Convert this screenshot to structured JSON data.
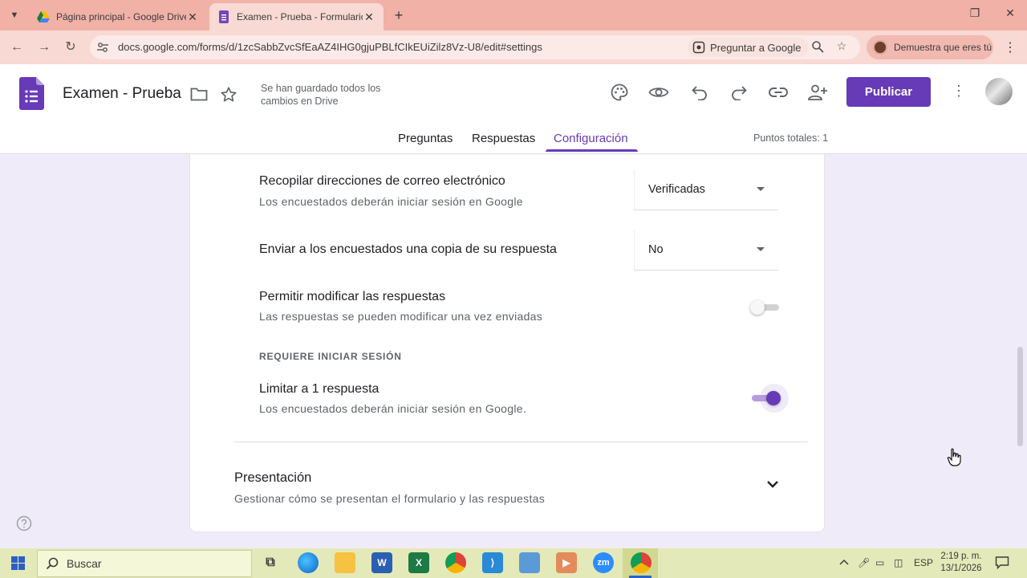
{
  "browser": {
    "tabs": [
      {
        "title": "Página principal - Google Drive",
        "active": false,
        "favicon": "google-drive-icon"
      },
      {
        "title": "Examen - Prueba - Formularios",
        "active": true,
        "favicon": "google-forms-icon"
      }
    ],
    "new_tab_glyph": "+",
    "url": "docs.google.com/forms/d/1zcSabbZvcSfEaAZ4IHG0gjuPBLfCIkEUiZilz8Vz-U8/edit#settings",
    "ask_google": "Preguntar a Google",
    "profile_chip": "Demuestra que eres tú"
  },
  "header": {
    "doc_title": "Examen - Prueba",
    "save_status": "Se han guardado todos los cambios en Drive",
    "publish_label": "Publicar",
    "tabs": [
      "Preguntas",
      "Respuestas",
      "Configuración"
    ],
    "active_tab": "Configuración",
    "total_points": "Puntos totales: 1"
  },
  "settings": {
    "collect_email": {
      "title": "Recopilar direcciones de correo electrónico",
      "subtitle": "Los encuestados deberán iniciar sesión en Google",
      "value": "Verificadas"
    },
    "send_copy": {
      "title": "Enviar a los encuestados una copia de su respuesta",
      "value": "No"
    },
    "allow_edit": {
      "title": "Permitir modificar las respuestas",
      "subtitle": "Las respuestas se pueden modificar una vez enviadas",
      "enabled": false
    },
    "section_label": "REQUIERE INICIAR SESIÓN",
    "limit_one": {
      "title": "Limitar a 1 respuesta",
      "subtitle": "Los encuestados deberán iniciar sesión en Google.",
      "enabled": true
    },
    "presentation": {
      "title": "Presentación",
      "subtitle": "Gestionar cómo se presentan el formulario y las respuestas"
    }
  },
  "taskbar": {
    "search_placeholder": "Buscar",
    "lang": "ESP",
    "time": "2:19 p. m.",
    "date": "13/1/2026",
    "apps": [
      "task-view",
      "edge",
      "file-explorer",
      "word",
      "excel",
      "chrome",
      "vscode",
      "remote-desktop",
      "media-player",
      "zoom",
      "chrome-active"
    ]
  },
  "colors": {
    "forms_purple": "#673ab7",
    "page_bg": "#f0ebf8",
    "browser_frame": "#f1b1a7",
    "taskbar": "#e4e9b9"
  }
}
